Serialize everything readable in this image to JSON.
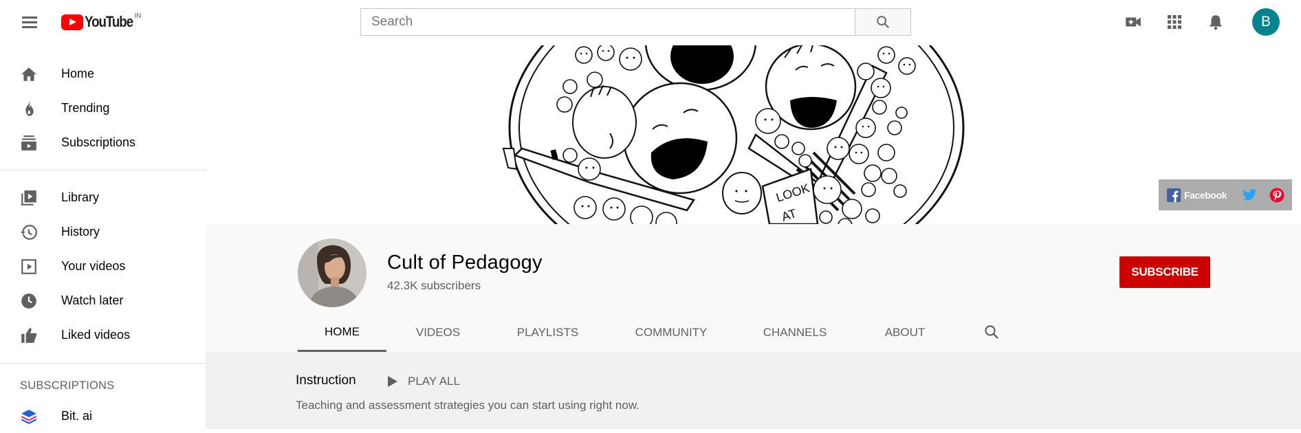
{
  "header": {
    "logo_text": "YouTube",
    "logo_country": "IN",
    "search_placeholder": "Search",
    "avatar_letter": "B",
    "icons": [
      "menu-icon",
      "search-icon",
      "video-camera-icon",
      "apps-grid-icon",
      "bell-icon"
    ]
  },
  "sidebar": {
    "primary": [
      {
        "label": "Home",
        "icon": "home-icon"
      },
      {
        "label": "Trending",
        "icon": "flame-icon"
      },
      {
        "label": "Subscriptions",
        "icon": "subscriptions-icon"
      }
    ],
    "library": [
      {
        "label": "Library",
        "icon": "library-icon"
      },
      {
        "label": "History",
        "icon": "history-icon"
      },
      {
        "label": "Your videos",
        "icon": "your-videos-icon"
      },
      {
        "label": "Watch later",
        "icon": "clock-icon"
      },
      {
        "label": "Liked videos",
        "icon": "thumbs-up-icon"
      }
    ],
    "subscriptions_heading": "SUBSCRIPTIONS",
    "subscriptions": [
      {
        "label": "Bit. ai",
        "icon": "bit-ai-logo-icon"
      }
    ]
  },
  "banner": {
    "social_links": [
      {
        "label": "Facebook",
        "icon": "facebook-icon"
      },
      {
        "label": "",
        "icon": "twitter-icon"
      },
      {
        "label": "",
        "icon": "pinterest-icon"
      }
    ],
    "sign_text": "LOOK AT"
  },
  "channel": {
    "name": "Cult of Pedagogy",
    "subscribers": "42.3K subscribers",
    "subscribe_label": "SUBSCRIBE",
    "tabs": [
      {
        "label": "HOME",
        "active": true
      },
      {
        "label": "VIDEOS",
        "active": false
      },
      {
        "label": "PLAYLISTS",
        "active": false
      },
      {
        "label": "COMMUNITY",
        "active": false
      },
      {
        "label": "CHANNELS",
        "active": false
      },
      {
        "label": "ABOUT",
        "active": false
      }
    ]
  },
  "shelf": {
    "title": "Instruction",
    "play_all_label": "PLAY ALL",
    "description": "Teaching and assessment strategies you can start using right now."
  },
  "colors": {
    "brand_red": "#ff0000",
    "subscribe_red": "#cc0000",
    "avatar_teal": "#00838f",
    "header_bg": "#f9f9f9",
    "shelf_bg": "#f1f1f1"
  }
}
